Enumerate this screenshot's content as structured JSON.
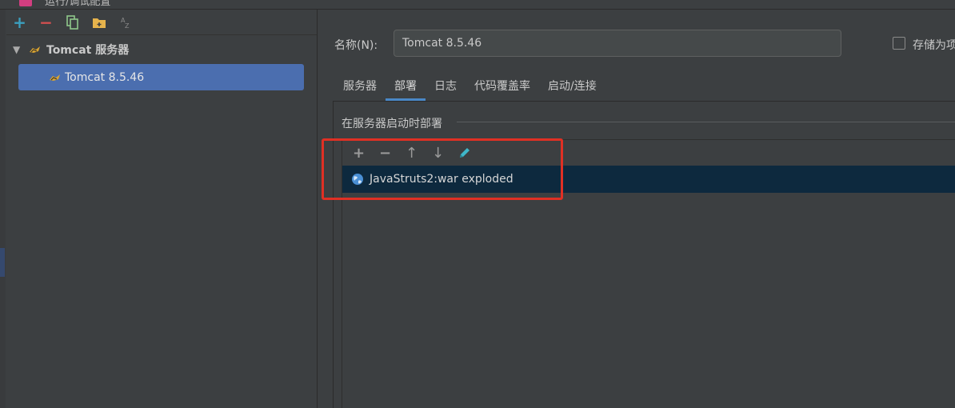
{
  "window": {
    "title": "运行/调试配置"
  },
  "left_toolbar": {
    "add_label": "+",
    "remove_label": "−"
  },
  "tree": {
    "group_label": "Tomcat 服务器",
    "items": [
      {
        "label": "Tomcat 8.5.46",
        "selected": true
      }
    ]
  },
  "form": {
    "name_label": "名称(N):",
    "name_value": "Tomcat 8.5.46",
    "store_label": "存储为项"
  },
  "tabs": [
    {
      "label": "服务器",
      "active": false
    },
    {
      "label": "部署",
      "active": true
    },
    {
      "label": "日志",
      "active": false
    },
    {
      "label": "代码覆盖率",
      "active": false
    },
    {
      "label": "启动/连接",
      "active": false
    }
  ],
  "deploy": {
    "section_title": "在服务器启动时部署",
    "toolbar": {
      "add": "+",
      "remove": "−",
      "up": "↑",
      "down": "↓"
    },
    "artifacts": [
      {
        "label": "JavaStruts2:war exploded"
      }
    ]
  },
  "colors": {
    "selection": "#4b6eaf",
    "row_highlight": "#0d293e",
    "annotation": "#e03024",
    "accent": "#3b9fbe"
  }
}
